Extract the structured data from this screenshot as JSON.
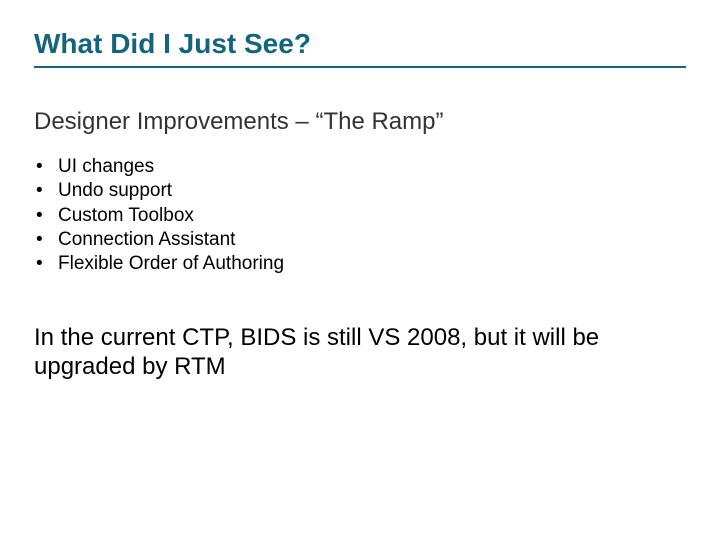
{
  "title": "What Did I Just See?",
  "subtitle": "Designer Improvements – “The Ramp”",
  "bullets": [
    "UI changes",
    "Undo support",
    "Custom Toolbox",
    "Connection Assistant",
    "Flexible Order of Authoring"
  ],
  "closing": "In the current CTP, BIDS is still VS 2008, but it will be upgraded by RTM",
  "colors": {
    "accent": "#14657a"
  }
}
